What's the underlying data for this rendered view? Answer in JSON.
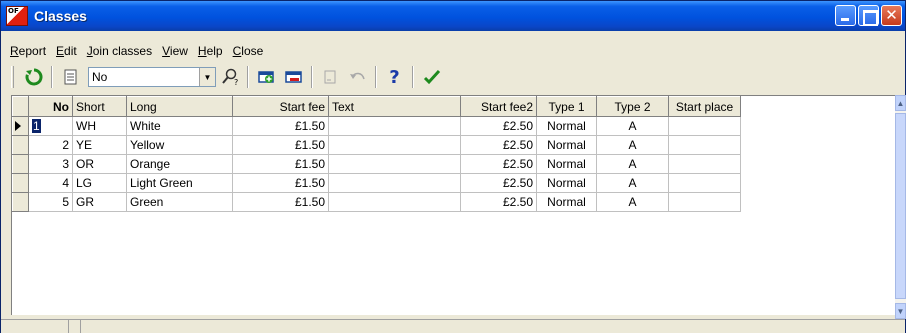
{
  "window": {
    "title": "Classes"
  },
  "menu": [
    "Report",
    "Edit",
    "Join classes",
    "View",
    "Help",
    "Close"
  ],
  "toolbar": {
    "combo_value": "No",
    "icons": [
      "refresh-icon",
      "report-icon",
      "search-help-icon",
      "add-row-icon",
      "delete-row-icon",
      "edit-disabled-icon",
      "undo-disabled-icon",
      "help-icon",
      "confirm-icon"
    ]
  },
  "grid": {
    "columns": [
      "No",
      "Short",
      "Long",
      "Start fee",
      "Text",
      "Start fee2",
      "Type 1",
      "Type 2",
      "Start place"
    ],
    "rows": [
      [
        "1",
        "WH",
        "White",
        "£1.50",
        "",
        "£2.50",
        "Normal",
        "A",
        ""
      ],
      [
        "2",
        "YE",
        "Yellow",
        "£1.50",
        "",
        "£2.50",
        "Normal",
        "A",
        ""
      ],
      [
        "3",
        "OR",
        "Orange",
        "£1.50",
        "",
        "£2.50",
        "Normal",
        "A",
        ""
      ],
      [
        "4",
        "LG",
        "Light Green",
        "£1.50",
        "",
        "£2.50",
        "Normal",
        "A",
        ""
      ],
      [
        "5",
        "GR",
        "Green",
        "£1.50",
        "",
        "£2.50",
        "Normal",
        "A",
        ""
      ]
    ]
  },
  "colors": {
    "title_bar": "#0052de",
    "close_button": "#c53a1c",
    "selection": "#0a246a"
  }
}
